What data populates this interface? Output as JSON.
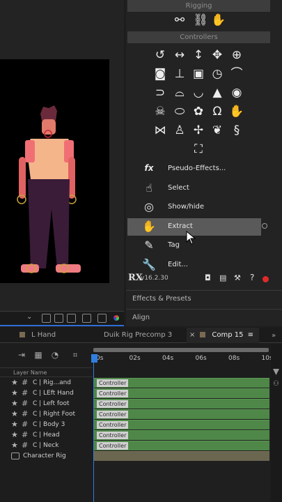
{
  "rigging": {
    "header": "Rigging",
    "icons": [
      "bone-link-icon",
      "bone-chain-icon",
      "hand-rig-icon"
    ]
  },
  "controllers": {
    "header": "Controllers",
    "icon_rows": [
      [
        {
          "name": "rotate-icon",
          "glyph": "↺"
        },
        {
          "name": "move-horizontal-icon",
          "glyph": "↔"
        },
        {
          "name": "move-vertical-icon",
          "glyph": "↕"
        },
        {
          "name": "move-4way-icon",
          "glyph": "✥"
        },
        {
          "name": "target-icon",
          "glyph": "⊕"
        }
      ],
      [
        {
          "name": "camera-icon",
          "glyph": "◙"
        },
        {
          "name": "slider-icon",
          "glyph": "⊥"
        },
        {
          "name": "dot-square-icon",
          "glyph": "▣"
        },
        {
          "name": "clock-icon",
          "glyph": "◷"
        },
        {
          "name": "eyebrow-icon",
          "glyph": "⌒"
        }
      ],
      [
        {
          "name": "ear-icon",
          "glyph": "⊃"
        },
        {
          "name": "hair-icon",
          "glyph": "⌓"
        },
        {
          "name": "mouth-icon",
          "glyph": "◡"
        },
        {
          "name": "nose-icon",
          "glyph": "▲"
        },
        {
          "name": "eye-icon",
          "glyph": "◉"
        }
      ],
      [
        {
          "name": "skull-icon",
          "glyph": "☠"
        },
        {
          "name": "foot-icon",
          "glyph": "⬭"
        },
        {
          "name": "paw-icon",
          "glyph": "✿"
        },
        {
          "name": "horseshoe-icon",
          "glyph": "Ω"
        },
        {
          "name": "hand-icon",
          "glyph": "✋"
        }
      ],
      [
        {
          "name": "butterfly-icon",
          "glyph": "⋈"
        },
        {
          "name": "body-icon",
          "glyph": "♙"
        },
        {
          "name": "wings-icon",
          "glyph": "✢"
        },
        {
          "name": "feather-icon",
          "glyph": "❦"
        },
        {
          "name": "seahorse-icon",
          "glyph": "§"
        }
      ],
      [
        {
          "name": "frame-icon",
          "glyph": "⛶"
        }
      ]
    ]
  },
  "tools": [
    {
      "name": "pseudo-effects",
      "label": "Pseudo-Effects...",
      "icon": "fx-icon",
      "glyph": "fx",
      "active": false
    },
    {
      "name": "select",
      "label": "Select",
      "icon": "pointer-hand-icon",
      "glyph": "☝",
      "active": false
    },
    {
      "name": "show-hide",
      "label": "Show/hide",
      "icon": "eye-hand-icon",
      "glyph": "◎",
      "active": false
    },
    {
      "name": "extract",
      "label": "Extract",
      "icon": "extract-hand-icon",
      "glyph": "✋",
      "active": true
    },
    {
      "name": "tag",
      "label": "Tag",
      "icon": "tag-hand-icon",
      "glyph": "✎",
      "active": false
    },
    {
      "name": "edit",
      "label": "Edit...",
      "icon": "wrench-icon",
      "glyph": "🔧",
      "active": false
    }
  ],
  "footer": {
    "logo": "RX",
    "version": "v16.2.30"
  },
  "panels": {
    "effects_presets": "Effects & Presets",
    "align": "Align"
  },
  "timeline": {
    "tabs": [
      {
        "label": "L Hand",
        "active": false
      },
      {
        "label": "Duik Rig Precomp 3",
        "active": false
      },
      {
        "label": "Comp 15",
        "active": true
      }
    ],
    "ruler_ticks": [
      "0s",
      "02s",
      "04s",
      "06s",
      "08s",
      "10s"
    ],
    "layer_column_header": "Layer Name",
    "layers": [
      {
        "name": "C | Rig...and",
        "track": "Controller"
      },
      {
        "name": "C | LEft Hand",
        "track": "Controller"
      },
      {
        "name": "C | Left foot",
        "track": "Controller"
      },
      {
        "name": "C | Right Foot",
        "track": "Controller"
      },
      {
        "name": "C | Body 3",
        "track": "Controller"
      },
      {
        "name": "C | Head",
        "track": "Controller"
      },
      {
        "name": "C | Neck",
        "track": "Controller"
      },
      {
        "name": "Character Rig",
        "track": ""
      }
    ]
  },
  "colors": {
    "accent_blue": "#2f7fe0",
    "track_green": "#4e8748",
    "active_tool_red": "#d32828"
  }
}
